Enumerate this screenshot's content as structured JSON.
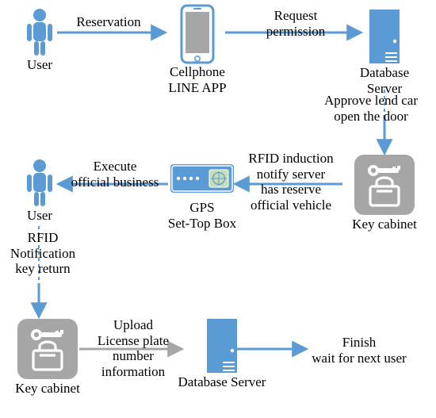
{
  "diagram": {
    "nodes": {
      "user_top": {
        "caption": "User"
      },
      "cellphone": {
        "caption": "Cellphone\nLINE APP"
      },
      "server_top": {
        "caption": "Database Server"
      },
      "cabinet_mid": {
        "caption": "Key cabinet"
      },
      "gps": {
        "caption": "GPS\nSet-Top Box"
      },
      "user_mid": {
        "caption": "User"
      },
      "cabinet_bot": {
        "caption": "Key cabinet"
      },
      "server_bot": {
        "caption": "Database Server"
      },
      "finish": {
        "caption": "Finish\nwait for next user"
      }
    },
    "edges": {
      "reservation": {
        "text": "Reservation"
      },
      "request": {
        "text": "Request\npermission"
      },
      "approve": {
        "text": "Approve lend car\nopen the door"
      },
      "rfid_notify": {
        "text": "RFID induction\nnotify server\nhas reserve\nofficial vehicle"
      },
      "execute": {
        "text": "Execute\nofficial business"
      },
      "rfid_return": {
        "text": "RFID\nNotification\nkey return"
      },
      "upload": {
        "text": "Upload\nLicense plate\nnumber\ninformation"
      }
    }
  },
  "colors": {
    "blue": "#5a9bd5",
    "gray": "#a6a6a6",
    "white": "#ffffff"
  }
}
